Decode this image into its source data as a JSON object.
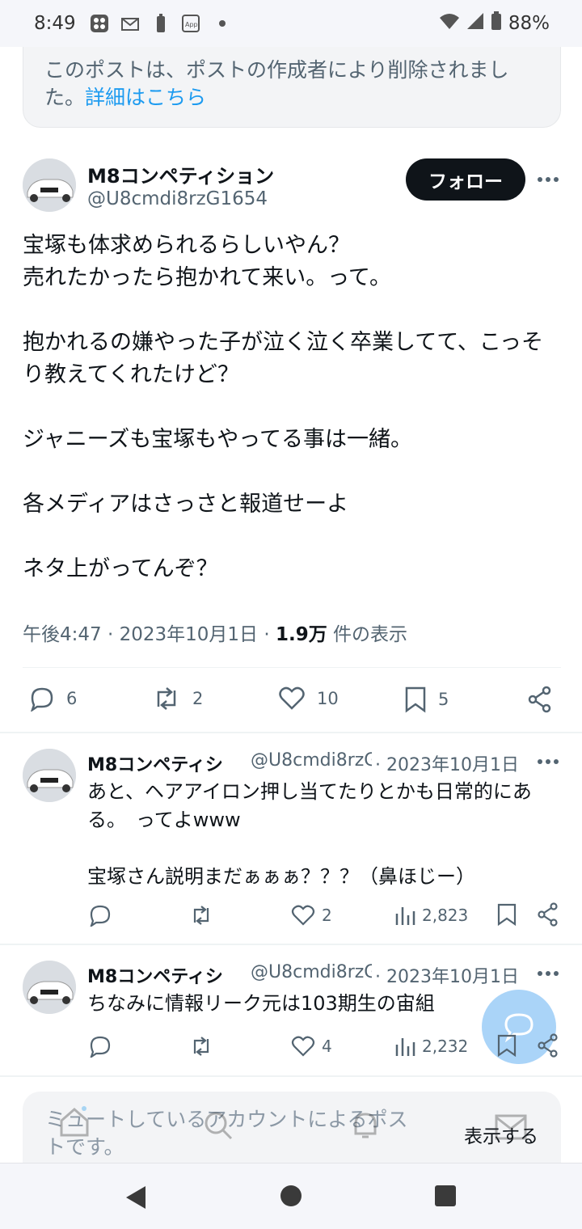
{
  "status_bar": {
    "time": "8:49",
    "battery": "88%"
  },
  "deleted_notice": {
    "text": "このポストは、ポストの作成者により削除されました。",
    "link": "詳細はこちら"
  },
  "main_post": {
    "name": "M8コンペティション",
    "handle": "@U8cmdi8rzG1654",
    "follow_label": "フォロー",
    "body": "宝塚も体求められるらしいやん？\n売れたかったら抱かれて来い。って。\n\n抱かれるの嫌やった子が泣く泣く卒業してて、こっそり教えてくれたけど？\n\nジャニーズも宝塚もやってる事は一緒。\n\n各メディアはさっさと報道せーよ\n\nネタ上がってんぞ？",
    "time": "午後4:47 · 2023年10月1日 · ",
    "views_count": "1.9万",
    "views_label": " 件の表示",
    "actions": {
      "replies": "6",
      "reposts": "2",
      "likes": "10",
      "bookmarks": "5"
    }
  },
  "replies": [
    {
      "name": "M8コンペティシ",
      "handle": "@U8cmdi8rzG",
      "date": "· 2023年10月1日",
      "text": "あと、ヘアアイロン押し当てたりとかも日常的にある。　ってよwww\n\n宝塚さん説明まだぁぁぁ？？？（鼻ほじー）",
      "likes": "2",
      "views": "2,823"
    },
    {
      "name": "M8コンペティシ",
      "handle": "@U8cmdi8rzG",
      "date": "· 2023年10月1日",
      "text": "ちなみに情報リーク元は103期生の宙組",
      "likes": "4",
      "views": "2,232"
    }
  ],
  "muted_notice": {
    "text": "ミュートしているアカウントによるポストです。",
    "button": "表示する"
  }
}
